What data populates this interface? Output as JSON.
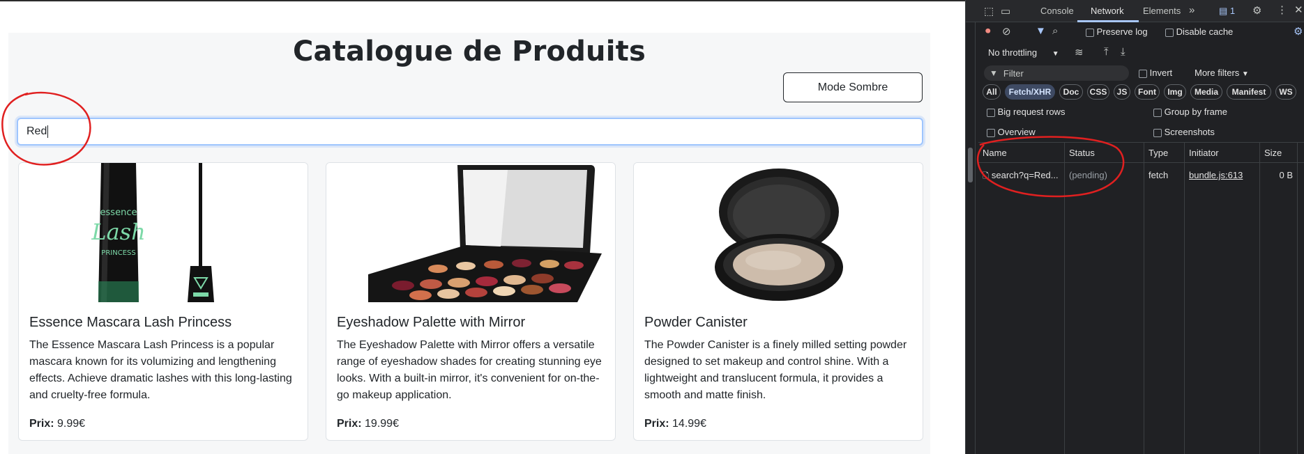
{
  "page": {
    "title": "Catalogue de Produits",
    "dark_mode_button": "Mode Sombre",
    "search_value": "Red",
    "products": [
      {
        "name": "Essence Mascara Lash Princess",
        "description": "The Essence Mascara Lash Princess is a popular mascara known for its volumizing and lengthening effects. Achieve dramatic lashes with this long-lasting and cruelty-free formula.",
        "price_label": "Prix:",
        "price": "9.99€",
        "image_icon": "mascara-image",
        "image_text": "essence",
        "image_text2": "Lash",
        "image_text3": "PRINCESS"
      },
      {
        "name": "Eyeshadow Palette with Mirror",
        "description": "The Eyeshadow Palette with Mirror offers a versatile range of eyeshadow shades for creating stunning eye looks. With a built-in mirror, it's convenient for on-the-go makeup application.",
        "price_label": "Prix:",
        "price": "19.99€",
        "image_icon": "eyeshadow-palette-image"
      },
      {
        "name": "Powder Canister",
        "description": "The Powder Canister is a finely milled setting powder designed to set makeup and control shine. With a lightweight and translucent formula, it provides a smooth and matte finish.",
        "price_label": "Prix:",
        "price": "14.99€",
        "image_icon": "powder-compact-image"
      }
    ]
  },
  "devtools": {
    "tabs": [
      "Console",
      "Network",
      "Elements"
    ],
    "active_tab": "Network",
    "issues_badge": "1",
    "toolbar": {
      "preserve_log": "Preserve log",
      "disable_cache": "Disable cache",
      "throttling": "No throttling"
    },
    "filter": {
      "placeholder": "Filter",
      "invert": "Invert",
      "more_filters": "More filters"
    },
    "type_chips": [
      "All",
      "Fetch/XHR",
      "Doc",
      "CSS",
      "JS",
      "Font",
      "Img",
      "Media",
      "Manifest",
      "WS"
    ],
    "active_chip": "Fetch/XHR",
    "options": {
      "big_request_rows": "Big request rows",
      "group_by_frame": "Group by frame",
      "overview": "Overview",
      "screenshots": "Screenshots"
    },
    "columns": [
      "Name",
      "Status",
      "Type",
      "Initiator",
      "Size"
    ],
    "requests": [
      {
        "name": "search?q=Red...",
        "status": "(pending)",
        "type": "fetch",
        "initiator": "bundle.js:613",
        "size": "0 B"
      }
    ]
  },
  "colors": {
    "annotation": "#e02020",
    "devtools_bg": "#202124",
    "active_chip": "#3e4a63"
  }
}
